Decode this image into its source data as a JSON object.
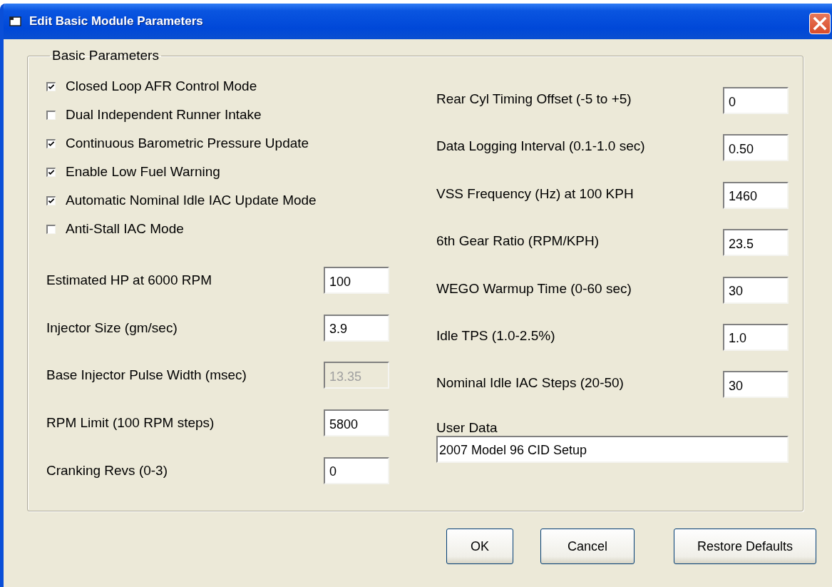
{
  "window": {
    "title": "Edit Basic Module Parameters"
  },
  "group": {
    "title": "Basic Parameters"
  },
  "checkboxes": [
    {
      "label": "Closed Loop AFR Control Mode",
      "checked": true
    },
    {
      "label": "Dual Independent Runner Intake",
      "checked": false
    },
    {
      "label": "Continuous Barometric Pressure Update",
      "checked": true
    },
    {
      "label": "Enable Low Fuel Warning",
      "checked": true
    },
    {
      "label": "Automatic Nominal Idle IAC Update Mode",
      "checked": true
    },
    {
      "label": "Anti-Stall IAC Mode",
      "checked": false
    }
  ],
  "left_fields": [
    {
      "label": "Estimated HP at 6000 RPM",
      "value": "100",
      "disabled": false
    },
    {
      "label": "Injector Size (gm/sec)",
      "value": "3.9",
      "disabled": false
    },
    {
      "label": "Base Injector Pulse Width (msec)",
      "value": "13.35",
      "disabled": true
    },
    {
      "label": "RPM Limit (100 RPM steps)",
      "value": "5800",
      "disabled": false
    },
    {
      "label": "Cranking Revs (0-3)",
      "value": "0",
      "disabled": false
    }
  ],
  "right_fields": [
    {
      "label": "Rear Cyl Timing Offset (-5 to +5)",
      "value": "0",
      "disabled": false
    },
    {
      "label": "Data Logging Interval (0.1-1.0 sec)",
      "value": "0.50",
      "disabled": false
    },
    {
      "label": "VSS Frequency (Hz)  at 100 KPH",
      "value": "1460",
      "disabled": false
    },
    {
      "label": "6th Gear Ratio (RPM/KPH)",
      "value": "23.5",
      "disabled": false
    },
    {
      "label": "WEGO Warmup Time (0-60 sec)",
      "value": "30",
      "disabled": false
    },
    {
      "label": "Idle TPS (1.0-2.5%)",
      "value": "1.0",
      "disabled": false
    },
    {
      "label": "Nominal Idle IAC Steps (20-50)",
      "value": "30",
      "disabled": false
    }
  ],
  "user_data": {
    "label": "User Data",
    "value": "2007 Model 96 CID Setup"
  },
  "buttons": [
    "OK",
    "Cancel",
    "Restore Defaults"
  ]
}
